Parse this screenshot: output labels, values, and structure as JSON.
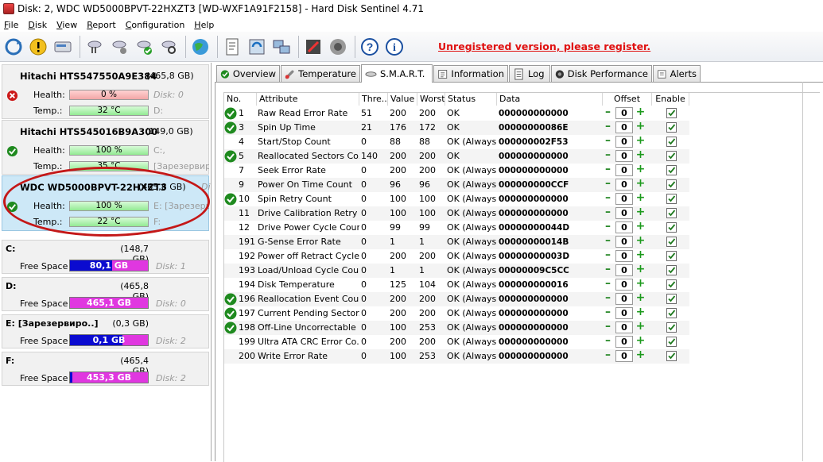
{
  "window": {
    "title": "Disk: 2, WDC WD5000BPVT-22HXZT3 [WD-WXF1A91F2158]  -  Hard Disk Sentinel 4.71"
  },
  "menu": [
    {
      "label": "File"
    },
    {
      "label": "Disk"
    },
    {
      "label": "View"
    },
    {
      "label": "Report"
    },
    {
      "label": "Configuration"
    },
    {
      "label": "Help"
    }
  ],
  "toolbar": {
    "unregistered": "Unregistered version, please register."
  },
  "disks": [
    {
      "name": "Hitachi HTS547550A9E384",
      "size": "(465,8 GB)",
      "health": "0 %",
      "health_fraction": 0.0,
      "health_side": "Disk: 0",
      "temp": "32 °C",
      "temp_side": "D:",
      "status": "error"
    },
    {
      "name": "Hitachi HTS545016B9A300",
      "size": "(149,0 GB)",
      "health": "100 %",
      "health_fraction": 1.0,
      "health_side": "C:,",
      "temp": "35 °C",
      "temp_side": "[Зарезервир",
      "status": "ok"
    },
    {
      "name": "WDC WD5000BPVT-22HXZT3",
      "size": "(465,8 GB)",
      "health": "100 %",
      "health_fraction": 1.0,
      "health_side": "E: [Зарезерв",
      "temp": "22 °C",
      "temp_side": "F:",
      "status": "ok",
      "size_tail": "Di"
    }
  ],
  "disk_labels": {
    "health": "Health:",
    "temp": "Temp.:"
  },
  "volumes": [
    {
      "name": "C:",
      "size": "(148,7 GB)",
      "free": "80,1 GB",
      "used_fraction": 0.54,
      "disk": "Disk: 1"
    },
    {
      "name": "D:",
      "size": "(465,8 GB)",
      "free": "465,1 GB",
      "used_fraction": 0.0,
      "disk": "Disk: 0"
    },
    {
      "name": "E: [Зарезервиро..]",
      "size": "(0,3 GB)",
      "free": "0,1 GB",
      "used_fraction": 0.67,
      "disk": "Disk: 2"
    },
    {
      "name": "F:",
      "size": "(465,4 GB)",
      "free": "453,3 GB",
      "used_fraction": 0.03,
      "disk": "Disk: 2"
    }
  ],
  "volume_labels": {
    "free_space": "Free Space"
  },
  "tabs": [
    {
      "label": "Overview",
      "icon": "check-circle-icon"
    },
    {
      "label": "Temperature",
      "icon": "thermometer-icon"
    },
    {
      "label": "S.M.A.R.T.",
      "icon": "disk-icon",
      "active": true
    },
    {
      "label": "Information",
      "icon": "info-icon"
    },
    {
      "label": "Log",
      "icon": "log-icon"
    },
    {
      "label": "Disk Performance",
      "icon": "performance-icon"
    },
    {
      "label": "Alerts",
      "icon": "alert-icon"
    }
  ],
  "smart": {
    "columns": [
      "No.",
      "Attribute",
      "Thre...",
      "Value",
      "Worst",
      "Status",
      "Data",
      "Offset",
      "Enable"
    ],
    "rows": [
      {
        "no": "1",
        "attr": "Raw Read Error Rate",
        "thr": "51",
        "val": "200",
        "worst": "200",
        "status": "OK",
        "data": "000000000000",
        "offset": "0",
        "ok_icon": true
      },
      {
        "no": "3",
        "attr": "Spin Up Time",
        "thr": "21",
        "val": "176",
        "worst": "172",
        "status": "OK",
        "data": "00000000086E",
        "offset": "0",
        "ok_icon": true
      },
      {
        "no": "4",
        "attr": "Start/Stop Count",
        "thr": "0",
        "val": "88",
        "worst": "88",
        "status": "OK (Always...",
        "data": "000000002F53",
        "offset": "0",
        "ok_icon": false
      },
      {
        "no": "5",
        "attr": "Reallocated Sectors Co...",
        "thr": "140",
        "val": "200",
        "worst": "200",
        "status": "OK",
        "data": "000000000000",
        "offset": "0",
        "ok_icon": true
      },
      {
        "no": "7",
        "attr": "Seek Error Rate",
        "thr": "0",
        "val": "200",
        "worst": "200",
        "status": "OK (Always...",
        "data": "000000000000",
        "offset": "0",
        "ok_icon": false
      },
      {
        "no": "9",
        "attr": "Power On Time Count",
        "thr": "0",
        "val": "96",
        "worst": "96",
        "status": "OK (Always...",
        "data": "000000000CCF",
        "offset": "0",
        "ok_icon": false
      },
      {
        "no": "10",
        "attr": "Spin Retry Count",
        "thr": "0",
        "val": "100",
        "worst": "100",
        "status": "OK (Always...",
        "data": "000000000000",
        "offset": "0",
        "ok_icon": true
      },
      {
        "no": "11",
        "attr": "Drive Calibration Retry ...",
        "thr": "0",
        "val": "100",
        "worst": "100",
        "status": "OK (Always...",
        "data": "000000000000",
        "offset": "0",
        "ok_icon": false
      },
      {
        "no": "12",
        "attr": "Drive Power Cycle Count",
        "thr": "0",
        "val": "99",
        "worst": "99",
        "status": "OK (Always...",
        "data": "00000000044D",
        "offset": "0",
        "ok_icon": false
      },
      {
        "no": "191",
        "attr": "G-Sense Error Rate",
        "thr": "0",
        "val": "1",
        "worst": "1",
        "status": "OK (Always...",
        "data": "00000000014B",
        "offset": "0",
        "ok_icon": false
      },
      {
        "no": "192",
        "attr": "Power off Retract Cycle ...",
        "thr": "0",
        "val": "200",
        "worst": "200",
        "status": "OK (Always...",
        "data": "00000000003D",
        "offset": "0",
        "ok_icon": false
      },
      {
        "no": "193",
        "attr": "Load/Unload Cycle Cou...",
        "thr": "0",
        "val": "1",
        "worst": "1",
        "status": "OK (Always...",
        "data": "00000009C5CC",
        "offset": "0",
        "ok_icon": false
      },
      {
        "no": "194",
        "attr": "Disk Temperature",
        "thr": "0",
        "val": "125",
        "worst": "104",
        "status": "OK (Always...",
        "data": "000000000016",
        "offset": "0",
        "ok_icon": false
      },
      {
        "no": "196",
        "attr": "Reallocation Event Count",
        "thr": "0",
        "val": "200",
        "worst": "200",
        "status": "OK (Always...",
        "data": "000000000000",
        "offset": "0",
        "ok_icon": true
      },
      {
        "no": "197",
        "attr": "Current Pending Sector...",
        "thr": "0",
        "val": "200",
        "worst": "200",
        "status": "OK (Always...",
        "data": "000000000000",
        "offset": "0",
        "ok_icon": true
      },
      {
        "no": "198",
        "attr": "Off-Line Uncorrectable ...",
        "thr": "0",
        "val": "100",
        "worst": "253",
        "status": "OK (Always...",
        "data": "000000000000",
        "offset": "0",
        "ok_icon": true
      },
      {
        "no": "199",
        "attr": "Ultra ATA CRC Error Co...",
        "thr": "0",
        "val": "200",
        "worst": "200",
        "status": "OK (Always...",
        "data": "000000000000",
        "offset": "0",
        "ok_icon": false
      },
      {
        "no": "200",
        "attr": "Write Error Rate",
        "thr": "0",
        "val": "100",
        "worst": "253",
        "status": "OK (Always...",
        "data": "000000000000",
        "offset": "0",
        "ok_icon": false
      }
    ]
  },
  "colors": {
    "ok_green": "#1f8a1f",
    "error_red": "#cc1a1a",
    "unregistered": "#e01010",
    "selected_disk": "#cde8f7",
    "highlight_ellipse": "#c41818"
  }
}
